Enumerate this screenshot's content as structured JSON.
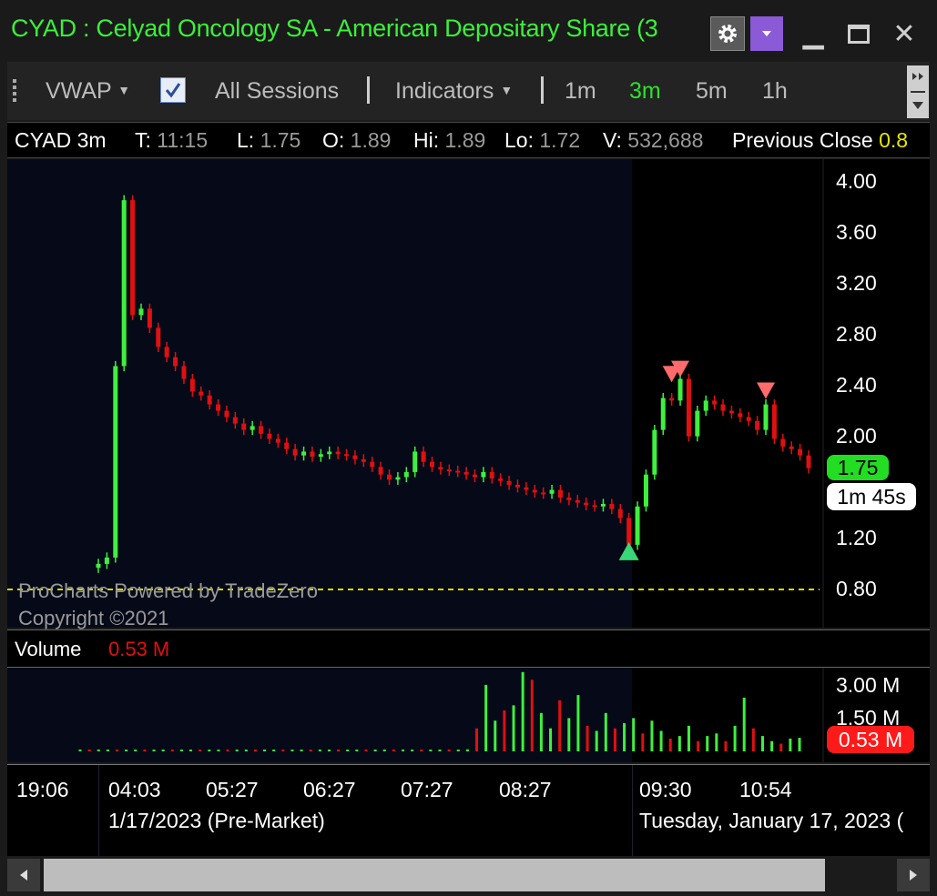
{
  "window": {
    "title": "CYAD : Celyad Oncology SA - American Depositary Share (3",
    "accent_title": "#3bf03b"
  },
  "toolbar": {
    "vwap_label": "VWAP",
    "sessions_label": "All Sessions",
    "sessions_checked": true,
    "indicators_label": "Indicators",
    "timeframes": [
      "1m",
      "3m",
      "5m",
      "1h"
    ],
    "active_timeframe": "3m"
  },
  "info": {
    "symbol_tf": "CYAD 3m",
    "t_label": "T:",
    "t_value": "11:15",
    "l_label": "L:",
    "l_value": "1.75",
    "o_label": "O:",
    "o_value": "1.89",
    "hi_label": "Hi:",
    "hi_value": "1.89",
    "lo_label": "Lo:",
    "lo_value": "1.72",
    "v_label": "V:",
    "v_value": "532,688",
    "prev_label": "Previous Close",
    "prev_value": "0.8"
  },
  "price_axis": {
    "ticks": [
      "4.00",
      "3.60",
      "3.20",
      "2.80",
      "2.40",
      "2.00",
      "1.20",
      "0.80"
    ],
    "last_price": "1.75",
    "countdown": "1m 45s"
  },
  "watermark": {
    "line1": "ProCharts Powered by TradeZero",
    "line2": "Copyright ©2021"
  },
  "volume": {
    "label": "Volume",
    "value": "0.53 M",
    "ticks": [
      "3.00 M",
      "1.50 M"
    ],
    "last_badge": "0.53 M"
  },
  "time_axis": {
    "ticks": [
      "19:06",
      "04:03",
      "05:27",
      "06:27",
      "07:27",
      "08:27",
      "09:30",
      "10:54"
    ],
    "premarket_label": "1/17/2023 (Pre-Market)",
    "session_label": "Tuesday, January 17, 2023 ("
  },
  "chart_data": {
    "type": "candlestick",
    "ylim": [
      0.8,
      4.1
    ],
    "previous_close": 0.8,
    "series": [
      {
        "name": "Price",
        "values": [
          1.0,
          1.05,
          2.55,
          3.85,
          2.95,
          3.0,
          2.85,
          2.7,
          2.62,
          2.55,
          2.45,
          2.35,
          2.32,
          2.25,
          2.2,
          2.15,
          2.1,
          2.05,
          2.08,
          2.02,
          1.98,
          1.95,
          1.9,
          1.85,
          1.88,
          1.84,
          1.86,
          1.88,
          1.86,
          1.85,
          1.82,
          1.8,
          1.76,
          1.7,
          1.66,
          1.68,
          1.72,
          1.88,
          1.8,
          1.76,
          1.74,
          1.73,
          1.72,
          1.7,
          1.68,
          1.72,
          1.67,
          1.65,
          1.62,
          1.6,
          1.58,
          1.56,
          1.55,
          1.58,
          1.52,
          1.5,
          1.48,
          1.46,
          1.45,
          1.47,
          1.43,
          1.36,
          1.15,
          1.45,
          1.7,
          2.05,
          2.3,
          2.28,
          2.45,
          2.0,
          2.2,
          2.28,
          2.25,
          2.2,
          2.18,
          2.15,
          2.12,
          2.05,
          2.25,
          1.98,
          1.92,
          1.9,
          1.85,
          1.75
        ]
      }
    ],
    "volume_values": [
      0.02,
      0.03,
      0.05,
      0.04,
      0.03,
      0.03,
      0.02,
      0.02,
      0.02,
      0.02,
      0.02,
      0.02,
      0.02,
      0.02,
      0.02,
      0.02,
      0.02,
      0.02,
      0.02,
      0.02,
      0.02,
      0.02,
      0.02,
      0.02,
      0.02,
      0.02,
      0.02,
      0.02,
      0.02,
      0.02,
      0.02,
      0.02,
      0.02,
      0.03,
      0.04,
      0.03,
      0.04,
      0.03,
      0.05,
      0.04,
      0.05,
      0.06,
      0.08,
      0.9,
      2.6,
      1.2,
      1.6,
      1.8,
      3.1,
      2.8,
      1.5,
      0.9,
      2.0,
      1.3,
      2.2,
      1.0,
      0.8,
      1.5,
      0.9,
      1.1,
      1.3,
      0.7,
      1.2,
      0.8,
      0.5,
      0.6,
      1.0,
      0.4,
      0.6,
      0.7,
      0.4,
      1.0,
      2.1,
      0.9,
      0.6,
      0.4,
      0.3,
      0.5,
      0.53
    ],
    "markers": [
      {
        "kind": "up-arrow",
        "x_index": 62,
        "price": 1.1
      },
      {
        "kind": "down-arrow",
        "x_index": 67,
        "price": 2.48
      },
      {
        "kind": "down-arrow",
        "x_index": 68,
        "price": 2.52
      },
      {
        "kind": "down-arrow",
        "x_index": 78,
        "price": 2.35
      }
    ],
    "colors": {
      "up": "#3ef03e",
      "down": "#e01010",
      "premarket_bg": "#060a18",
      "session_bg": "#000000"
    }
  }
}
